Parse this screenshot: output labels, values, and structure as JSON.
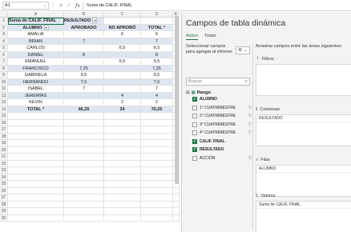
{
  "formula_bar": {
    "cell_ref": "A1",
    "chevron": "⌄",
    "dots": "⋮",
    "cancel": "✕",
    "confirm": "✓",
    "fx": "fx",
    "content": "Suma de CALIF. FINAL"
  },
  "grid": {
    "columns": [
      "A",
      "B",
      "C",
      "D",
      "E"
    ],
    "row_numbers": [
      "1",
      "2",
      "3",
      "4",
      "5",
      "6",
      "7",
      "8",
      "9",
      "10",
      "11",
      "12",
      "13",
      "14",
      "15",
      "16",
      "17",
      "18",
      "19",
      "20",
      "21",
      "22",
      "23",
      "24",
      "25",
      "26",
      "27",
      "28",
      "29",
      "30"
    ],
    "pivot_title": "Suma de CALIF. FINAL",
    "resultado_header": "RESULTADO",
    "headers": [
      "ALUMNO",
      "APROBADO",
      "NO APROBÓ",
      "TOTAL *"
    ],
    "rows": [
      [
        "AMALIA",
        "",
        "6",
        "6"
      ],
      [
        "BRIAN",
        "7",
        "",
        "7"
      ],
      [
        "CARLOS",
        "",
        "6,5",
        "6,5"
      ],
      [
        "DANIEL",
        "8",
        "",
        "8"
      ],
      [
        "EMANUEL",
        "",
        "5,5",
        "5,5"
      ],
      [
        "FRANCISCO",
        "7,25",
        "",
        "7,25"
      ],
      [
        "GABRIELA",
        "9,5",
        "",
        "9,5"
      ],
      [
        "HERNANDO",
        "7,5",
        "",
        "7,5"
      ],
      [
        "ISABEL",
        "7",
        "",
        "7"
      ],
      [
        "JEREMÍAS",
        "",
        "4",
        "4"
      ],
      [
        "KEVIN",
        "",
        "2",
        "2"
      ]
    ],
    "total": [
      "TOTAL *",
      "46,25",
      "24",
      "70,25"
    ]
  },
  "pane": {
    "title": "Campos de tabla dinámica",
    "tabs": [
      "Activo",
      "Todas"
    ],
    "select_label": "Seleccionar campos para agregar al informe:",
    "gear_icon": "⚙ ⌄",
    "search_placeholder": "Buscar",
    "search_icon": "⌕",
    "group": "Rango",
    "group_toggle": "⊟",
    "group_icon": "▦",
    "fields": [
      {
        "label": "ALUMNO",
        "checked": true
      },
      {
        "label": "1° CUATRIMESTRE",
        "checked": false
      },
      {
        "label": "2° CUATRIMESTRE",
        "checked": false
      },
      {
        "label": "3° CUATRIMESTRE",
        "checked": false
      },
      {
        "label": "4° CUATRIMESTRE",
        "checked": false
      },
      {
        "label": "CALIF. FINAL",
        "checked": true
      },
      {
        "label": "RESULTADO",
        "checked": true
      },
      {
        "label": "ACCIÓN",
        "checked": false
      }
    ],
    "drag_label": "Arrastrar campos entre las áreas siguientes:",
    "areas": {
      "filtros": {
        "title": "Filtros",
        "icon": "⊤",
        "items": []
      },
      "columnas": {
        "title": "Columnas",
        "icon": "⦀",
        "items": [
          "RESULTADO"
        ]
      },
      "filas": {
        "title": "Filas",
        "icon": "≡",
        "items": [
          "ALUMNO"
        ]
      },
      "valores": {
        "title": "Valores",
        "icon": "Σ",
        "items": [
          "Suma de CALIF. FINAL"
        ]
      }
    }
  },
  "colors": {
    "accent": "#217346",
    "header_fill": "#dde5f0",
    "pane_bg": "#f3f3f3"
  }
}
